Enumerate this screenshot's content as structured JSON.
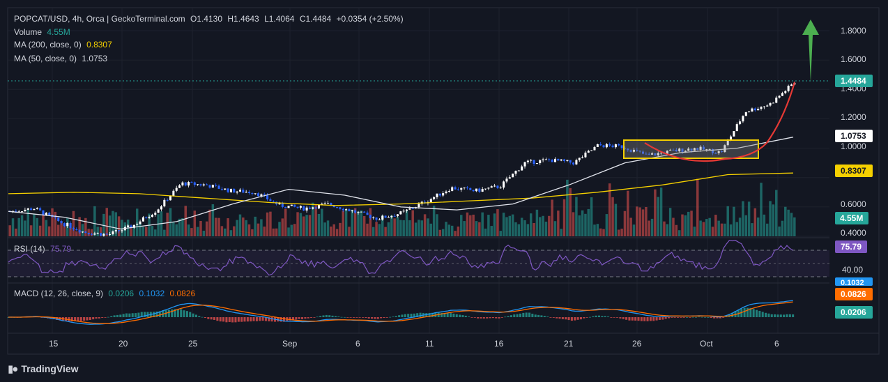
{
  "header": {
    "symbol": "POPCAT/USD, 4h, Orca | GeckoTerminal.com",
    "open": "O1.4130",
    "high": "H1.4643",
    "low": "L1.4064",
    "close": "C1.4484",
    "change": "+0.0354 (+2.50%)"
  },
  "legend": {
    "volume_label": "Volume",
    "volume_value": "4.55M",
    "ma200_label": "MA (200, close, 0)",
    "ma200_value": "0.8307",
    "ma50_label": "MA (50, close, 0)",
    "ma50_value": "1.0753"
  },
  "rsi": {
    "label": "RSI (14)",
    "value": "75.79",
    "axis_label": "40.00",
    "overbought": 70,
    "oversold": 30
  },
  "macd": {
    "label": "MACD (12, 26, close, 9)",
    "hist_value": "0.0206",
    "macd_value": "0.1032",
    "signal_value": "0.0826"
  },
  "price_axis": {
    "ticks": [
      "1.8000",
      "1.6000",
      "1.4000",
      "1.2000",
      "1.0000",
      "0.6000",
      "0.4000"
    ],
    "last_price": "1.4484",
    "ma50_tag": "1.0753",
    "ma200_tag": "0.8307",
    "volume_tag": "4.55M",
    "rsi_tag": "75.79",
    "macd_tags": [
      "0.1032",
      "0.0826",
      "0.0206"
    ]
  },
  "time_axis": [
    "15",
    "20",
    "25",
    "Sep",
    "6",
    "11",
    "16",
    "21",
    "26",
    "Oct",
    "6"
  ],
  "brand": "TradingView",
  "colors": {
    "background": "#131722",
    "up": "#26a69a",
    "down": "#ef5350",
    "ma200": "#f5d000",
    "ma50": "#e0e3eb",
    "rsi": "#7e57c2",
    "macd": "#2196f3",
    "signal": "#ff6d00",
    "arrow": "#4caf50",
    "box": "#f5d000",
    "cup": "#e53935"
  },
  "chart_data": {
    "type": "candlestick",
    "timeframe": "4h",
    "y_axis": {
      "min": 0.4,
      "max": 1.8,
      "scale": "linear"
    },
    "series": [
      {
        "name": "MA (200, close, 0)",
        "last": 0.8307
      },
      {
        "name": "MA (50, close, 0)",
        "last": 1.0753
      }
    ],
    "close_path": [
      {
        "x": "Aug 11",
        "y": 0.57
      },
      {
        "x": "Aug 13",
        "y": 0.59
      },
      {
        "x": "Aug 15",
        "y": 0.5
      },
      {
        "x": "Aug 17",
        "y": 0.43
      },
      {
        "x": "Aug 19",
        "y": 0.41
      },
      {
        "x": "Aug 21",
        "y": 0.47
      },
      {
        "x": "Aug 23",
        "y": 0.58
      },
      {
        "x": "Aug 24",
        "y": 0.76
      },
      {
        "x": "Aug 26",
        "y": 0.75
      },
      {
        "x": "Aug 28",
        "y": 0.71
      },
      {
        "x": "Aug 30",
        "y": 0.7
      },
      {
        "x": "Sep 1",
        "y": 0.61
      },
      {
        "x": "Sep 3",
        "y": 0.59
      },
      {
        "x": "Sep 5",
        "y": 0.62
      },
      {
        "x": "Sep 7",
        "y": 0.57
      },
      {
        "x": "Sep 8",
        "y": 0.52
      },
      {
        "x": "Sep 10",
        "y": 0.56
      },
      {
        "x": "Sep 12",
        "y": 0.64
      },
      {
        "x": "Sep 14",
        "y": 0.73
      },
      {
        "x": "Sep 16",
        "y": 0.71
      },
      {
        "x": "Sep 18",
        "y": 0.74
      },
      {
        "x": "Sep 19",
        "y": 0.9
      },
      {
        "x": "Sep 21",
        "y": 0.92
      },
      {
        "x": "Sep 23",
        "y": 0.9
      },
      {
        "x": "Sep 25",
        "y": 1.02
      },
      {
        "x": "Sep 27",
        "y": 1.01
      },
      {
        "x": "Sep 29",
        "y": 0.95
      },
      {
        "x": "Oct 1",
        "y": 0.98
      },
      {
        "x": "Oct 3",
        "y": 1.0
      },
      {
        "x": "Oct 4",
        "y": 0.97
      },
      {
        "x": "Oct 5",
        "y": 1.25
      },
      {
        "x": "Oct 6",
        "y": 1.3
      },
      {
        "x": "Oct 7",
        "y": 1.4484
      }
    ],
    "ma200_path": [
      0.69,
      0.7,
      0.69,
      0.66,
      0.63,
      0.61,
      0.62,
      0.64,
      0.66,
      0.7,
      0.75,
      0.82,
      0.8307
    ],
    "ma50_path": [
      0.57,
      0.53,
      0.45,
      0.5,
      0.62,
      0.72,
      0.68,
      0.6,
      0.58,
      0.62,
      0.75,
      0.9,
      0.97,
      1.0,
      1.0753
    ],
    "annotations": [
      "consolidation box",
      "cup curve",
      "up arrow"
    ]
  }
}
